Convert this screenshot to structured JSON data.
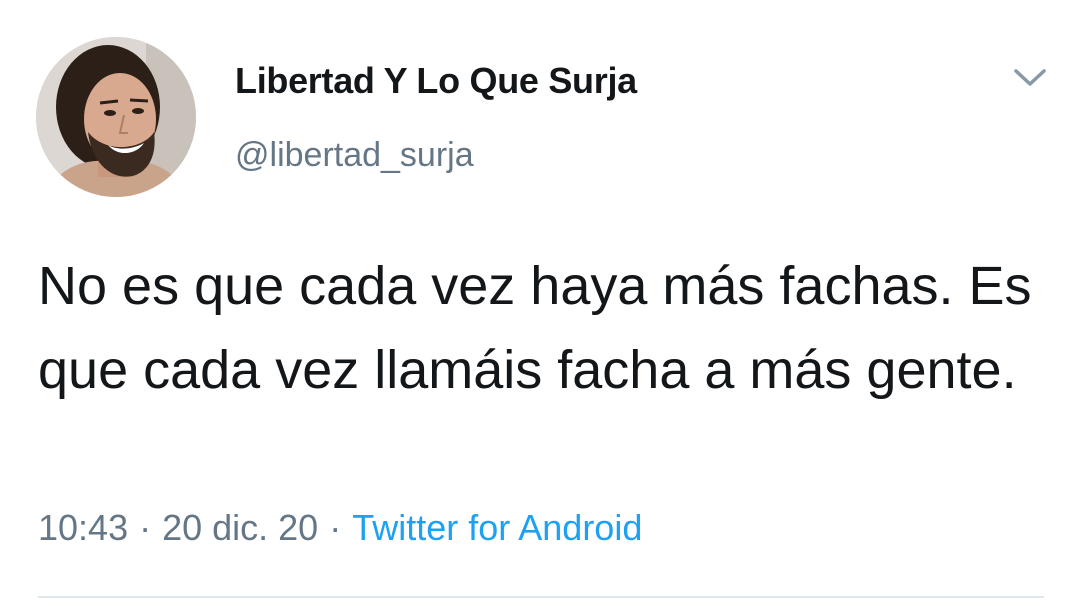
{
  "user": {
    "display_name": "Libertad Y Lo Que Surja",
    "handle": "@libertad_surja",
    "avatar_icon": "profile-photo"
  },
  "tweet": {
    "text": "No es que cada vez haya más fachas. Es que cada vez llamáis facha a más gente.",
    "time": "10:43",
    "date": "20 dic. 20",
    "separator": "·",
    "source": "Twitter for Android"
  },
  "menu": {
    "icon": "chevron-down-icon"
  },
  "colors": {
    "text": "#14171a",
    "secondary": "#657786",
    "link": "#1da1f2",
    "divider": "#e1e8ed"
  }
}
